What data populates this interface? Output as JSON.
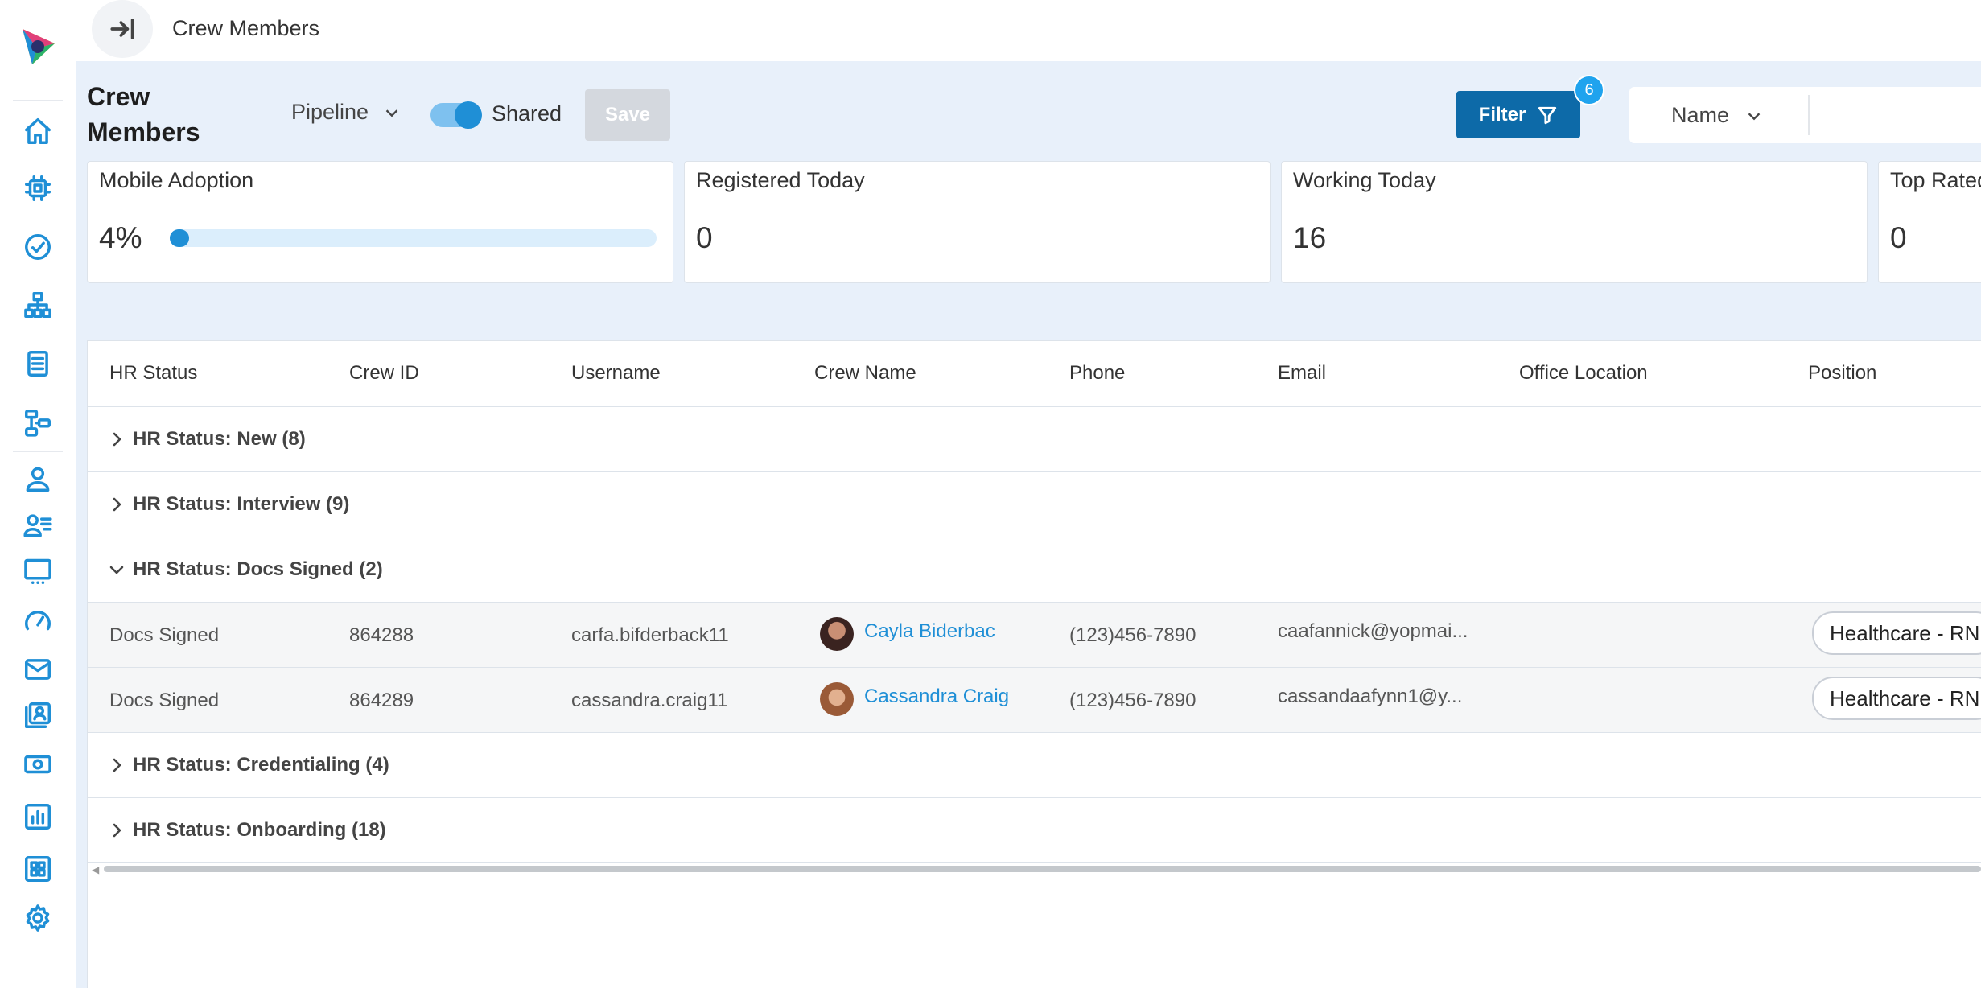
{
  "topbar": {
    "breadcrumb": "Crew Members"
  },
  "toolbar": {
    "title": "Crew Members",
    "view_select": "Pipeline",
    "shared_label": "Shared",
    "shared_on": true,
    "save_label": "Save",
    "filter_label": "Filter",
    "filter_count": "6",
    "search_field": "Name"
  },
  "stats": [
    {
      "title": "Mobile Adoption",
      "value": "4%",
      "progress": 0.04
    },
    {
      "title": "Registered Today",
      "value": "0"
    },
    {
      "title": "Working Today",
      "value": "16"
    },
    {
      "title": "Top Rated",
      "value": "0"
    }
  ],
  "table": {
    "columns": [
      "HR Status",
      "Crew ID",
      "Username",
      "Crew Name",
      "Phone",
      "Email",
      "Office Location",
      "Position"
    ],
    "groups": [
      {
        "label": "HR Status: New (8)",
        "expanded": false
      },
      {
        "label": "HR Status: Interview (9)",
        "expanded": false
      },
      {
        "label": "HR Status: Docs Signed (2)",
        "expanded": true
      },
      {
        "label": "HR Status: Credentialing (4)",
        "expanded": false
      },
      {
        "label": "HR Status: Onboarding (18)",
        "expanded": false
      }
    ],
    "rows": [
      {
        "hr_status": "Docs Signed",
        "crew_id": "864288",
        "username": "carfa.bifderback11",
        "crew_name": "Cayla Biderbac",
        "phone": "(123)456-7890",
        "email": "caafannick@yopmai...",
        "office_location": "",
        "position": "Healthcare - RN"
      },
      {
        "hr_status": "Docs Signed",
        "crew_id": "864289",
        "username": "cassandra.craig11",
        "crew_name": "Cassandra Craig",
        "phone": "(123)456-7890",
        "email": "cassandaafynn1@y...",
        "office_location": "",
        "position": "Healthcare - RN"
      }
    ]
  },
  "sidebar": {
    "icons": [
      "home-icon",
      "chip-icon",
      "check-circle-icon",
      "org-chart-icon",
      "document-icon",
      "workflow-icon",
      "user-icon",
      "user-list-icon",
      "monitor-icon",
      "gauge-icon",
      "mail-icon",
      "id-card-icon",
      "money-icon",
      "bar-chart-icon",
      "grid-icon",
      "gear-icon"
    ]
  },
  "colors": {
    "accent": "#1f8fd6",
    "filter_button": "#0d6aa8",
    "badge": "#1fa3ee",
    "page_bg": "#e8f0fa"
  }
}
